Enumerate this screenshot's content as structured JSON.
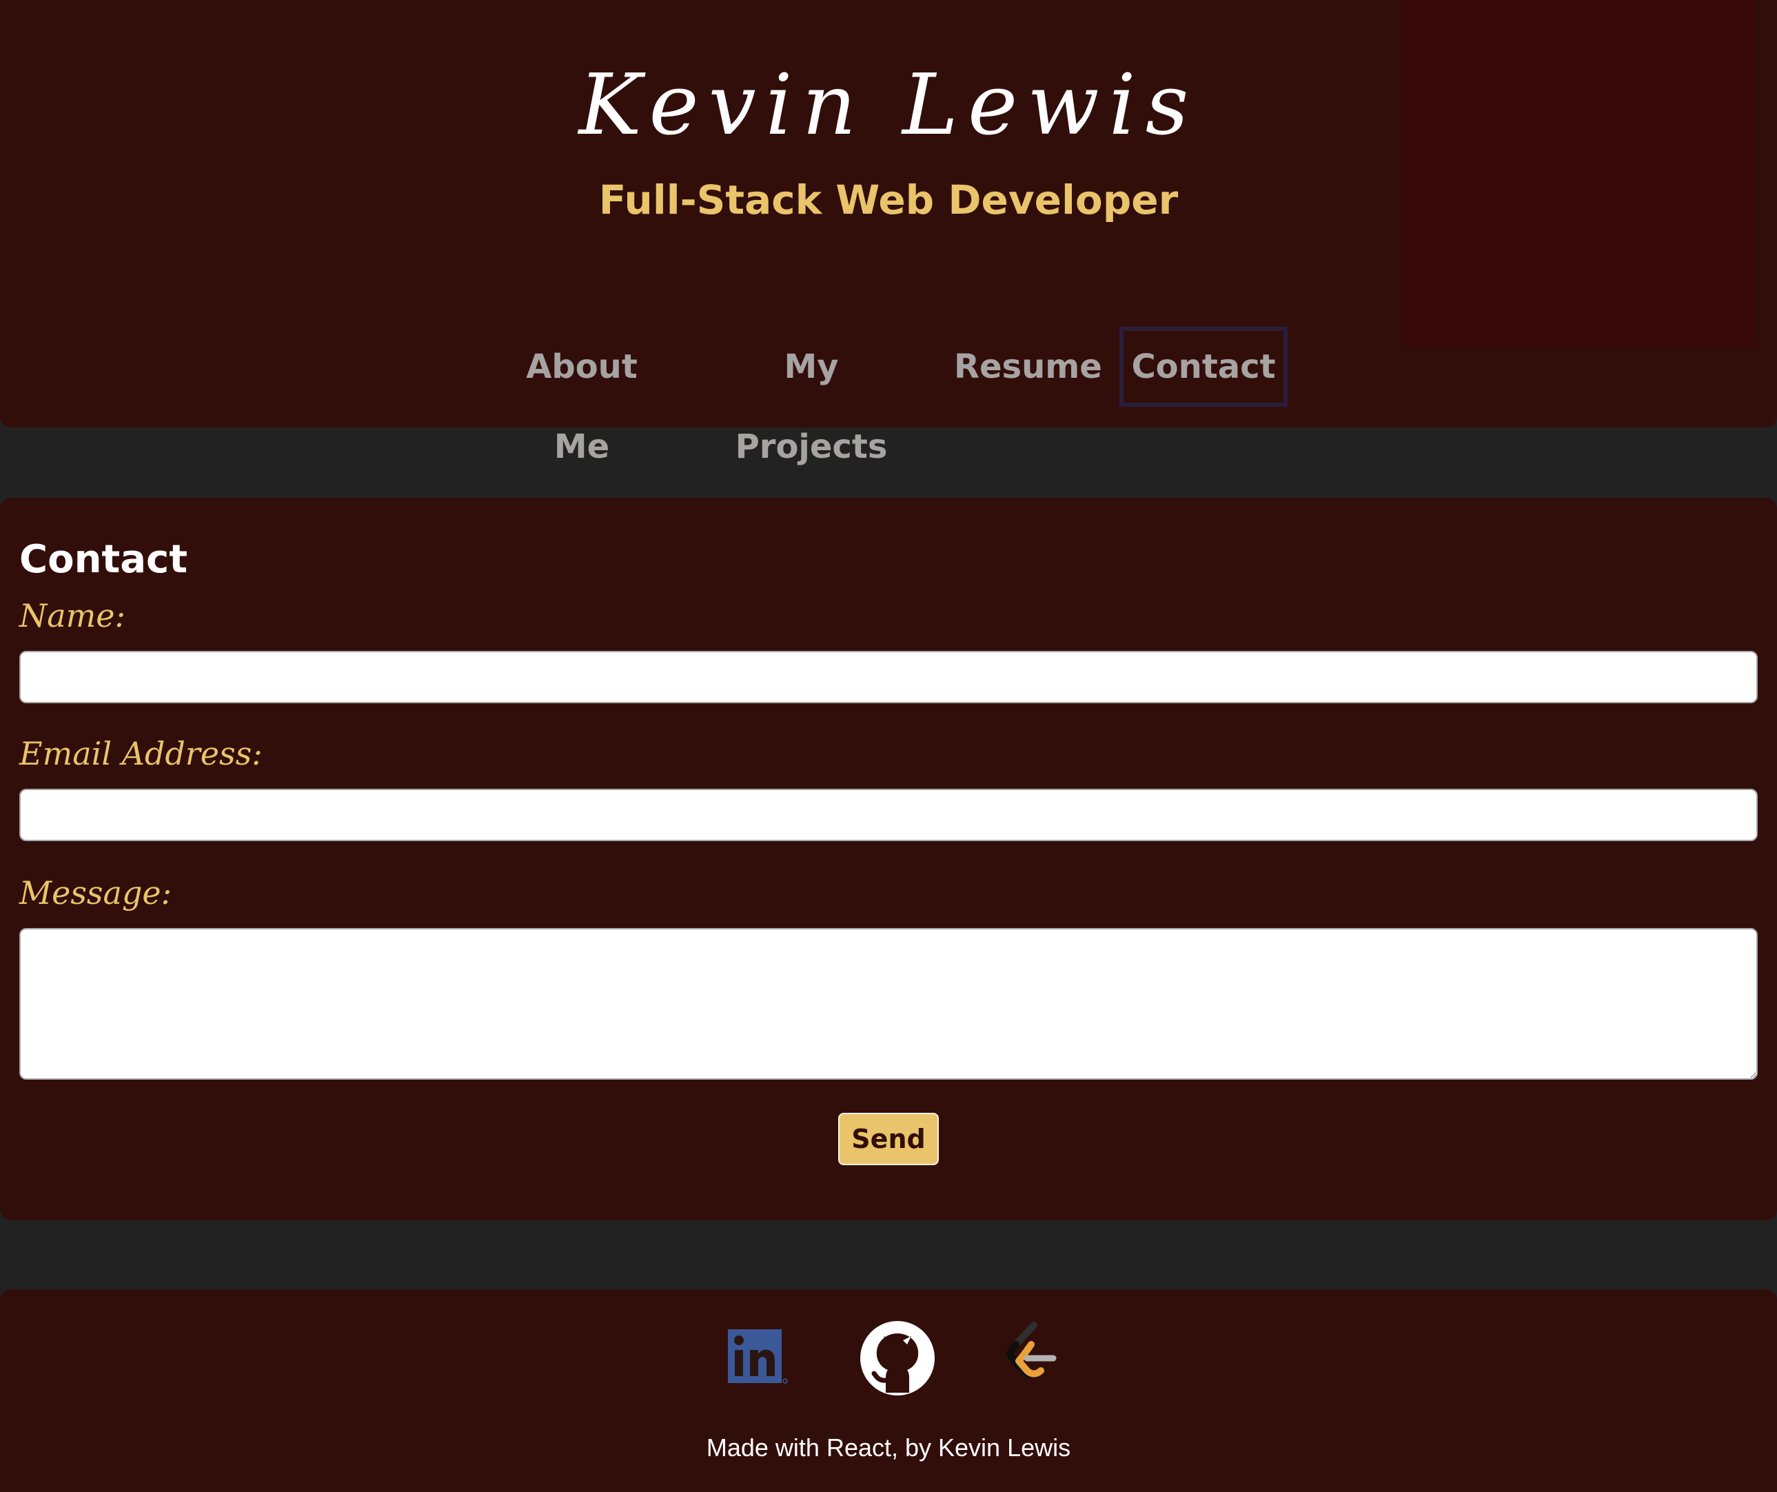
{
  "header": {
    "title": "Kevin Lewis",
    "subtitle": "Full-Stack Web Developer"
  },
  "nav": {
    "items": [
      {
        "label": "About Me"
      },
      {
        "label": "My Projects"
      },
      {
        "label": "Resume"
      },
      {
        "label": "Contact"
      }
    ],
    "active": "Contact"
  },
  "contact": {
    "heading": "Contact",
    "name_label": "Name:",
    "name_value": "",
    "email_label": "Email Address:",
    "email_value": "",
    "message_label": "Message:",
    "message_value": "",
    "send_label": "Send"
  },
  "footer": {
    "social": [
      {
        "icon": "linkedin-icon",
        "color": "#3b5998"
      },
      {
        "icon": "github-icon",
        "color": "#ffffff"
      },
      {
        "icon": "leetcode-icon",
        "color": "#e9a23b"
      }
    ],
    "credit": "Made with React, by Kevin Lewis"
  },
  "colors": {
    "background": "#222222",
    "panel": "#320e0b",
    "accent": "#e9c46a",
    "nav_text": "#a7a3a3",
    "active_border": "#2a1d3c"
  }
}
